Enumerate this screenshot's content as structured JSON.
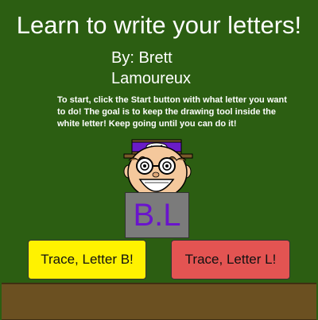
{
  "header": {
    "title": "Learn to write your letters!",
    "byline_line1": "By: Brett",
    "byline_line2": "Lamoureux"
  },
  "instructions": "To start, click the Start button with what letter you want to do! The goal is to keep the drawing tool inside the white letter! Keep going until you can do it!",
  "board": {
    "letters": "B.L"
  },
  "buttons": {
    "trace_b": "Trace, Letter B!",
    "trace_l": "Trace, Letter L!"
  },
  "colors": {
    "background": "#2c5e12",
    "button_b": "#fff200",
    "button_l": "#e35452",
    "ground": "#6b5021",
    "letters": "#6a14cc"
  },
  "icons": {
    "character": "cartoon-teacher-icon"
  }
}
